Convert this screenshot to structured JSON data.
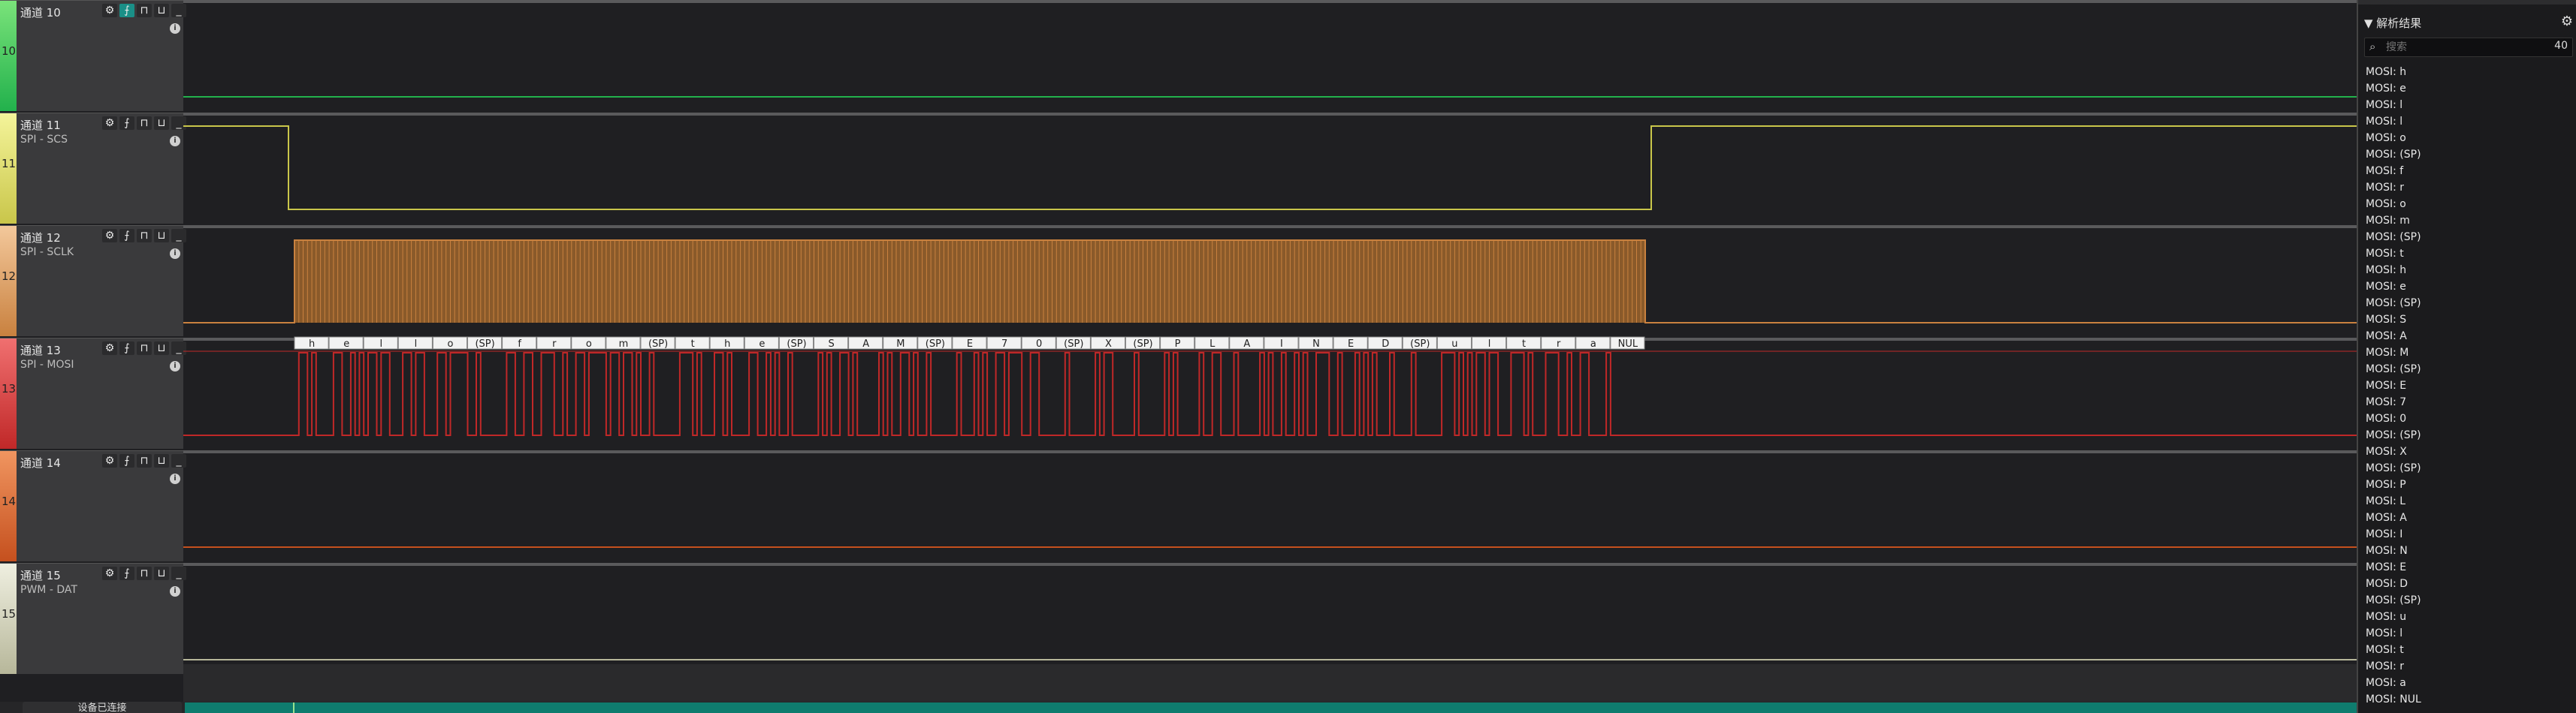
{
  "channels": [
    {
      "num": "10",
      "name": "通道 10",
      "sub": "",
      "color": "#22b14c",
      "strip_top": "#7ae37a"
    },
    {
      "num": "11",
      "name": "通道 11",
      "sub": "SPI - SCS",
      "color": "#c9c64a",
      "strip_top": "#f4f49a"
    },
    {
      "num": "12",
      "name": "通道 12",
      "sub": "SPI - SCLK",
      "color": "#c9813f",
      "strip_top": "#f3c89b"
    },
    {
      "num": "13",
      "name": "通道 13",
      "sub": "SPI - MOSI",
      "color": "#c02828",
      "strip_top": "#f07070"
    },
    {
      "num": "14",
      "name": "通道 14",
      "sub": "",
      "color": "#c5501e",
      "strip_top": "#f09560"
    },
    {
      "num": "15",
      "name": "通道 15",
      "sub": "PWM - DAT",
      "color": "#b7b79a",
      "strip_top": "#efefe0"
    }
  ],
  "tool_icons": [
    "gear-icon",
    "edge-trigger-icon",
    "pulse-high-icon",
    "pulse-low-icon",
    "minimize-icon"
  ],
  "decoded_bytes": [
    "h",
    "e",
    "l",
    "l",
    "o",
    "(SP)",
    "f",
    "r",
    "o",
    "m",
    "(SP)",
    "t",
    "h",
    "e",
    "(SP)",
    "S",
    "A",
    "M",
    "(SP)",
    "E",
    "7",
    "0",
    "(SP)",
    "X",
    "(SP)",
    "P",
    "L",
    "A",
    "I",
    "N",
    "E",
    "D",
    "(SP)",
    "u",
    "l",
    "t",
    "r",
    "a",
    "NUL"
  ],
  "results_panel": {
    "title": "▼ 解析结果",
    "search_placeholder": "搜索",
    "count": "40",
    "items": [
      "MOSI: h",
      "MOSI: e",
      "MOSI: l",
      "MOSI: l",
      "MOSI: o",
      "MOSI: (SP)",
      "MOSI: f",
      "MOSI: r",
      "MOSI: o",
      "MOSI: m",
      "MOSI: (SP)",
      "MOSI: t",
      "MOSI: h",
      "MOSI: e",
      "MOSI: (SP)",
      "MOSI: S",
      "MOSI: A",
      "MOSI: M",
      "MOSI: (SP)",
      "MOSI: E",
      "MOSI: 7",
      "MOSI: 0",
      "MOSI: (SP)",
      "MOSI: X",
      "MOSI: (SP)",
      "MOSI: P",
      "MOSI: L",
      "MOSI: A",
      "MOSI: I",
      "MOSI: N",
      "MOSI: E",
      "MOSI: D",
      "MOSI: (SP)",
      "MOSI: u",
      "MOSI: l",
      "MOSI: t",
      "MOSI: r",
      "MOSI: a",
      "MOSI: NUL"
    ]
  },
  "status": {
    "label": "设备已连接"
  }
}
